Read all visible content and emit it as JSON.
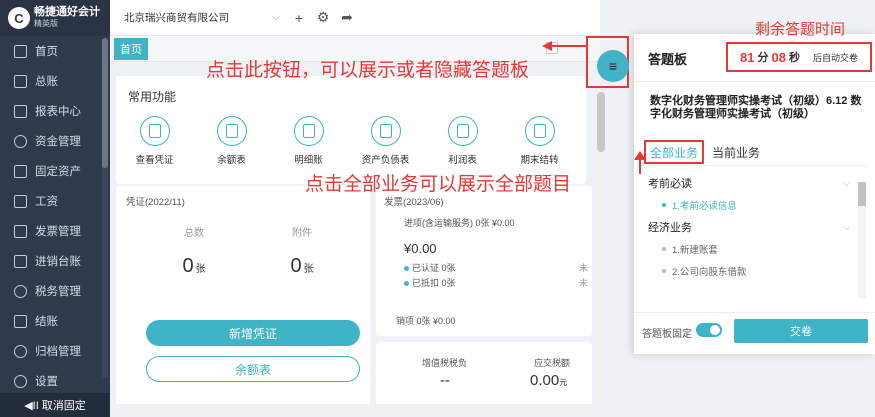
{
  "sidebar": {
    "logo_mark": "C",
    "logo_name": "畅捷通好会计",
    "logo_sub": "精英版",
    "items": [
      {
        "label": "首页",
        "icon": "home-icon"
      },
      {
        "label": "总账",
        "icon": "ledger-icon"
      },
      {
        "label": "报表中心",
        "icon": "chart-icon"
      },
      {
        "label": "资金管理",
        "icon": "money-icon"
      },
      {
        "label": "固定资产",
        "icon": "asset-icon"
      },
      {
        "label": "工资",
        "icon": "salary-icon"
      },
      {
        "label": "发票管理",
        "icon": "invoice-icon"
      },
      {
        "label": "进销台账",
        "icon": "inventory-icon"
      },
      {
        "label": "税务管理",
        "icon": "tax-icon"
      },
      {
        "label": "结账",
        "icon": "checkout-icon"
      },
      {
        "label": "归档管理",
        "icon": "archive-icon"
      },
      {
        "label": "设置",
        "icon": "settings-icon"
      }
    ],
    "cancel_fixed": "取消固定",
    "cancel_glyph": "◀II"
  },
  "topbar": {
    "company": "北京瑞兴商贸有限公司",
    "chevron": "⌵",
    "plus": "+",
    "gear": "⚙",
    "share": "➦"
  },
  "tabs": {
    "home": "首页"
  },
  "quick": {
    "title": "常用功能",
    "items": [
      "查看凭证",
      "余额表",
      "明细账",
      "资产负债表",
      "利润表",
      "期末结转"
    ]
  },
  "voucher": {
    "title": "凭证(2022/11)",
    "total_label": "总数",
    "total_value": "0",
    "attach_label": "附件",
    "attach_value": "0",
    "unit": "张",
    "add_button": "新增凭证",
    "balance_button": "余额表"
  },
  "invoice": {
    "title": "发票(2023/06)",
    "input_line": "进项(含运输服务)  0张  ¥0.00",
    "amount": "¥0.00",
    "certified": "已认证  0张",
    "deducted": "已抵扣  0张",
    "unsold": "未",
    "output_line": "销项   0张   ¥0.00"
  },
  "tax": {
    "vat_label": "增值税税负",
    "vat_value": "--",
    "due_label": "应交税额",
    "due_value": "0.00",
    "due_unit": "元"
  },
  "panel": {
    "title": "答题板",
    "minutes": "81",
    "min_unit": "分",
    "seconds": "08",
    "sec_unit": "秒",
    "auto_submit": "后自动交卷",
    "exam_title": "数字化财务管理师实操考试（初级）6.12 数字化财务管理师实操考试（初级）",
    "tab_all": "全部业务",
    "tab_current": "当前业务",
    "groups": [
      {
        "name": "考前必读",
        "items": [
          {
            "label": "1.考前必读信息",
            "active": true
          }
        ]
      },
      {
        "name": "经济业务",
        "items": [
          {
            "label": "1.新建账套",
            "active": false
          },
          {
            "label": "2.公司向股东借款",
            "active": false
          }
        ]
      }
    ],
    "caret": "⌵",
    "pin_label": "答题板固定",
    "submit": "交卷",
    "toggle_glyph": "≡"
  },
  "annotations": {
    "timer": "剩余答题时间",
    "toggle": "点击此按钮，可以展示或者隐藏答题板",
    "all_tasks": "点击全部业务可以展示全部题目"
  },
  "colors": {
    "accent": "#3fb4c7",
    "annotation": "#e53935",
    "sidebar": "#2f3a4c"
  }
}
